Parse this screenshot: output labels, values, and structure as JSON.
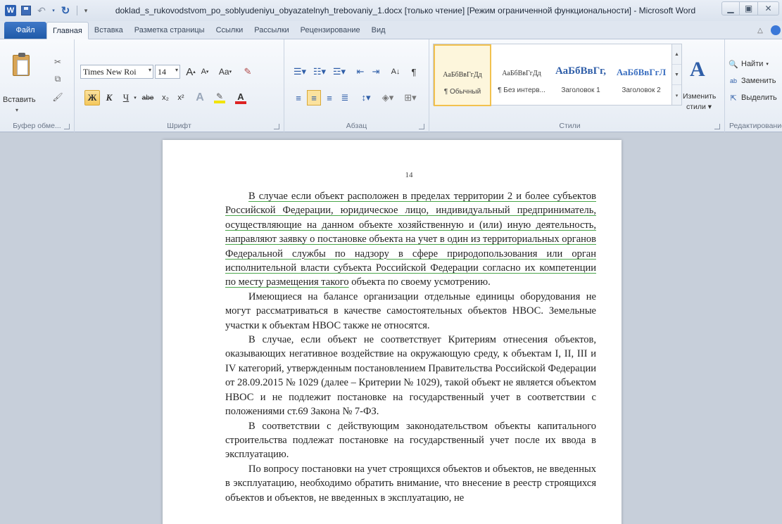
{
  "window": {
    "title": "doklad_s_rukovodstvom_po_soblyudeniyu_obyazatelnyh_trebovaniy_1.docx [только чтение] [Режим ограниченной функциональности] - Microsoft Word",
    "app_icon": "W"
  },
  "tabs": {
    "file": "Файл",
    "items": [
      "Главная",
      "Вставка",
      "Разметка страницы",
      "Ссылки",
      "Рассылки",
      "Рецензирование",
      "Вид"
    ],
    "active": "Главная"
  },
  "ribbon": {
    "clipboard": {
      "paste_label": "Вставить",
      "group_label": "Буфер обме..."
    },
    "font": {
      "font_name": "Times New Roi",
      "font_size": "14",
      "grow_label": "A",
      "shrink_label": "A",
      "case_label": "Aa",
      "bold": "Ж",
      "italic": "К",
      "underline": "Ч",
      "strike": "abe",
      "subscript": "x₂",
      "superscript": "x²",
      "highlight_color": "#f2e400",
      "font_color": "#d22",
      "group_label": "Шрифт"
    },
    "paragraph": {
      "group_label": "Абзац"
    },
    "styles": {
      "items": [
        {
          "sample": "АаБбВвГгДд",
          "name": "¶ Обычный"
        },
        {
          "sample": "АаБбВвГгДд",
          "name": "¶ Без интерв..."
        },
        {
          "sample": "АаБбВвГг,",
          "name": "Заголовок 1"
        },
        {
          "sample": "АаБбВвГгЛ",
          "name": "Заголовок 2"
        }
      ],
      "change_styles": "Изменить стили",
      "group_label": "Стили"
    },
    "editing": {
      "find": "Найти",
      "replace": "Заменить",
      "select": "Выделить",
      "group_label": "Редактирование"
    }
  },
  "document": {
    "page_number": "14",
    "paragraphs": [
      {
        "id": "p1",
        "segments": [
          {
            "text": "В случае если объект расположен в пределах территории 2 и более субъектов Российской Федерации, юридическое лицо, индивидуальный предприниматель, осуществляющие на данном объекте хозяйственную и (или) иную деятельность, направляют заявку о постановке объекта на учет в один из территориальных органов Федеральной службы по надзору в сфере природопользования или орган исполнительной власти субъекта Российской Федерации согласно их компетенции по месту размещения такого",
            "underline": true
          },
          {
            "text": " объекта по своему усмотрению.",
            "underline": false
          }
        ]
      },
      {
        "id": "p2",
        "text": "Имеющиеся на балансе организации отдельные единицы оборудования не могут рассматриваться в качестве самостоятельных объектов НВОС. Земельные участки к объектам НВОС также не относятся."
      },
      {
        "id": "p3",
        "text": "В случае, если объект не соответствует Критериям отнесения объектов, оказывающих негативное воздействие на окружающую среду, к объектам I, II, III и IV категорий, утвержденным постановлением Правительства Российской Федерации от 28.09.2015 № 1029 (далее – Критерии № 1029), такой объект не является объектом НВОС и не подлежит постановке на государственный учет в соответствии с положениями ст.69 Закона № 7-ФЗ."
      },
      {
        "id": "p4",
        "text": "В соответствии с действующим законодательством объекты капитального строительства подлежат постановке на государственный учет после их ввода в эксплуатацию."
      },
      {
        "id": "p5",
        "text": "По вопросу постановки на учет строящихся объектов и объектов, не введенных в эксплуатацию, необходимо обратить внимание, что внесение в реестр строящихся объектов и объектов, не введенных в эксплуатацию, не"
      }
    ]
  }
}
